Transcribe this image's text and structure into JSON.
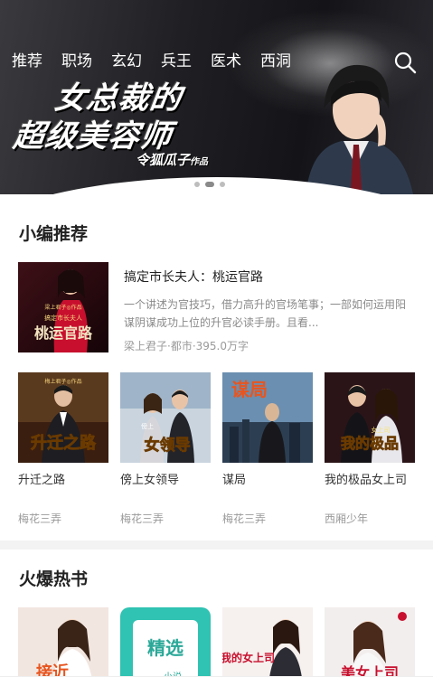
{
  "nav": {
    "tabs": [
      "推荐",
      "职场",
      "玄幻",
      "兵王",
      "医术",
      "西洞"
    ]
  },
  "banner": {
    "title_line1": "女总裁的",
    "title_line2": "超级美容师",
    "author": "令狐瓜子",
    "author_suffix": "作品",
    "slide_count": 3,
    "active_slide": 1
  },
  "editor_picks": {
    "title": "小编推荐",
    "featured": {
      "title": "搞定市长夫人：桃运官路",
      "description": "一个讲述为官技巧，借力高升的官场笔事；一部如何运用阳谋阴谋成功上位的升官必读手册。且看...",
      "meta": "梁上君子·都市·395.0万字",
      "cover_text_top": "梁上君子◎作品",
      "cover_text_sub": "搞定市长夫人",
      "cover_text_main": "桃运官路"
    },
    "books": [
      {
        "name": "升迁之路",
        "author": "梅花三弄",
        "cover_text": "升迁之路",
        "cover_top": "梅上君子◎作品"
      },
      {
        "name": "傍上女领导",
        "author": "梅花三弄",
        "cover_text": "女领导",
        "cover_top": "傍上"
      },
      {
        "name": "谋局",
        "author": "梅花三弄",
        "cover_text": "谋局"
      },
      {
        "name": "我的极品女上司",
        "author": "西厢少年",
        "cover_text": "我的极品",
        "cover_top": "女上司"
      }
    ]
  },
  "hot_books": {
    "title": "火爆热书",
    "covers": [
      {
        "cover_text": "接近"
      },
      {
        "cover_text": "精选",
        "cover_sub": "小说"
      },
      {
        "cover_text": "我的女上司"
      },
      {
        "cover_text": "美女上司"
      }
    ]
  },
  "colors": {
    "accent_red": "#c8102e",
    "gray_text": "#9a9a9a",
    "divider": "#f3f3f3"
  }
}
